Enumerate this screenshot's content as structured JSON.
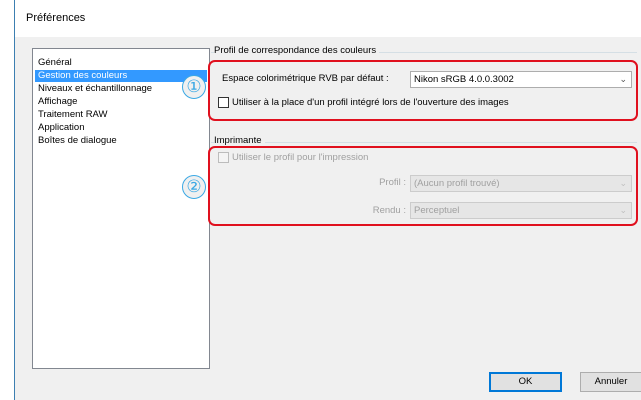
{
  "window": {
    "title": "Préférences"
  },
  "sidebar": {
    "items": [
      {
        "label": "Général",
        "selected": false
      },
      {
        "label": "Gestion des couleurs",
        "selected": true
      },
      {
        "label": "Niveaux et échantillonnage",
        "selected": false
      },
      {
        "label": "Affichage",
        "selected": false
      },
      {
        "label": "Traitement RAW",
        "selected": false
      },
      {
        "label": "Application",
        "selected": false
      },
      {
        "label": "Boîtes de dialogue",
        "selected": false
      }
    ]
  },
  "color_profile": {
    "group_label": "Profil de correspondance des couleurs",
    "rgb_space_label": "Espace colorimétrique RVB par défaut :",
    "rgb_space_value": "Nikon sRGB 4.0.0.3002",
    "embedded_checkbox_label": "Utiliser à la place d'un profil intégré lors de l'ouverture des images",
    "embedded_checked": false
  },
  "printer": {
    "group_label": "Imprimante",
    "use_profile_label": "Utiliser le profil pour l'impression",
    "use_profile_checked": false,
    "profile_label": "Profil :",
    "profile_value": "(Aucun profil trouvé)",
    "rendering_label": "Rendu :",
    "rendering_value": "Perceptuel"
  },
  "callouts": {
    "one": "①",
    "two": "②"
  },
  "buttons": {
    "ok": "OK",
    "cancel": "Annuler"
  },
  "colors": {
    "selection": "#3399ff",
    "callout_border": "#e0101e",
    "badge": "#3aa8e4"
  }
}
